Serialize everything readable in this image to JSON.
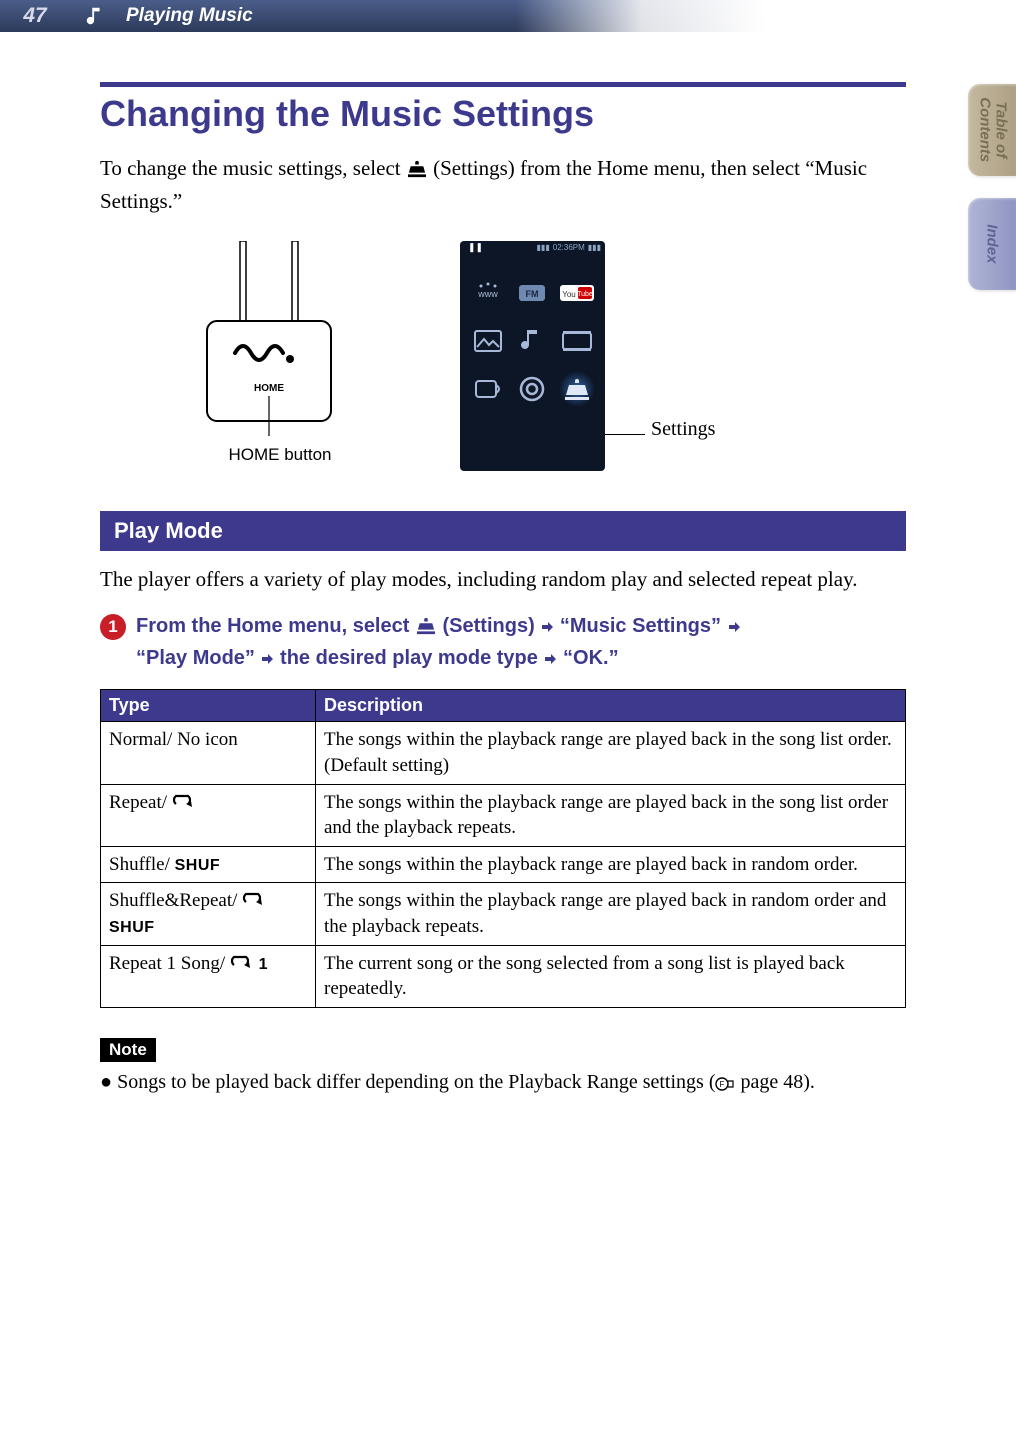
{
  "page_number": "47",
  "section": "Playing Music",
  "side_tabs": {
    "toc": "Table of\nContents",
    "index": "Index"
  },
  "heading": "Changing the Music Settings",
  "intro_pre": "To change the music settings, select ",
  "intro_mid": " (Settings) from the Home menu, then select “Music Settings.”",
  "device": {
    "home_text": "HOME",
    "label": "HOME button"
  },
  "screenshot": {
    "status_time": "02:36PM",
    "settings_label": "Settings"
  },
  "subsection": "Play Mode",
  "subsection_intro": "The player offers a variety of play modes, including random play and selected repeat play.",
  "step": {
    "num": "1",
    "p1": "From the Home menu, select ",
    "p2": " (Settings) ",
    "p3": " “Music Settings” ",
    "p4": " “Play Mode” ",
    "p5": " the desired play mode type ",
    "p6": " “OK.”"
  },
  "table": {
    "headers": {
      "type": "Type",
      "desc": "Description"
    },
    "rows": [
      {
        "type": "Normal/ No icon",
        "desc": "The songs within the playback range are played back in the song list order. (Default setting)"
      },
      {
        "type": "Repeat/ ",
        "desc": "The songs within the playback range are played back in the song list order and the playback repeats."
      },
      {
        "type": "Shuffle/ ",
        "shuf": "SHUF",
        "desc": "The songs within the playback range are played back in random order."
      },
      {
        "type": "Shuffle&Repeat/ ",
        "shuf": "SHUF",
        "desc": "The songs within the playback range are played back in random order and the playback repeats."
      },
      {
        "type": "Repeat 1 Song/ ",
        "one": "1",
        "desc": "The current song or the song selected from a song list is played back repeatedly."
      }
    ]
  },
  "note_label": "Note",
  "note_text": "Songs to be played back differ depending on the Playback Range settings (",
  "note_page": " page 48)."
}
